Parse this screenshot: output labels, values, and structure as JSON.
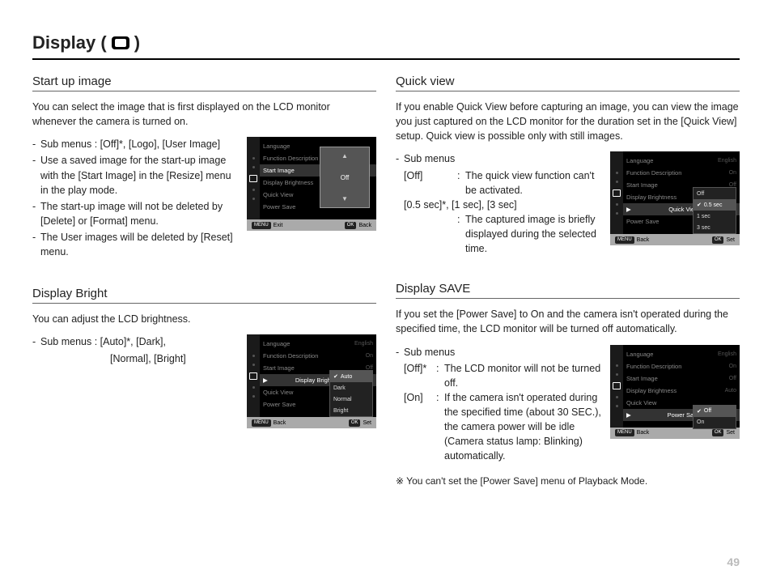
{
  "page": {
    "title_prefix": "Display (",
    "title_suffix": " )",
    "page_number": "49"
  },
  "sections": {
    "startup": {
      "title": "Start up image",
      "intro": "You can select the image that is first displayed on the LCD monitor whenever the camera is turned on.",
      "b1": "Sub menus : [Off]*, [Logo], [User Image]",
      "b2": "Use a saved image for the start-up image with the [Start Image] in the [Resize] menu in the play mode.",
      "b3": "The start-up image will not be deleted by [Delete] or [Format] menu.",
      "b4": "The User images will be deleted by [Reset] menu."
    },
    "bright": {
      "title": "Display Bright",
      "intro": "You can adjust the LCD brightness.",
      "b1": "Sub menus : [Auto]*, [Dark], [Normal], [Bright]",
      "b1_l2": "[Normal], [Bright]"
    },
    "quick": {
      "title": "Quick view",
      "intro": "If you enable Quick View before capturing an image, you can view the image you just captured on the LCD monitor for the duration set in the [Quick View] setup. Quick view is possible only with still images.",
      "sub_label": "Sub menus",
      "off_label": "[Off]",
      "off_desc": "The quick view function can't be activated.",
      "opts_label": "[0.5 sec]*, [1 sec], [3 sec]",
      "opts_desc": "The captured image is briefly displayed during the selected time."
    },
    "save": {
      "title": "Display SAVE",
      "intro": "If you set the [Power Save] to On and the camera isn't operated during the specified time, the LCD monitor will be turned off automatically.",
      "sub_label": "Sub menus",
      "off_label": "[Off]*",
      "off_desc": "The LCD monitor will not be turned off.",
      "on_label": "[On]",
      "on_desc": "If the camera isn't operated during the specified time (about 30 SEC.), the camera power will be idle (Camera status lamp: Blinking) automatically.",
      "footnote": "※ You can't set the [Power Save] menu of Playback Mode."
    }
  },
  "menu_labels": {
    "language": "Language",
    "func_desc": "Function Description",
    "start_image": "Start Image",
    "disp_bright": "Display  Brightness",
    "quick_view": "Quick View",
    "power_save": "Power Save"
  },
  "menu_values": {
    "english": "English",
    "on": "On",
    "off": "Off",
    "auto": "Auto",
    "sec05": "0.5 sec"
  },
  "footer": {
    "menu_key": "MENU",
    "ok_key": "OK",
    "exit": "Exit",
    "back": "Back",
    "set": "Set"
  },
  "popup": {
    "off": "Off"
  },
  "submenu_bright": {
    "auto": "Auto",
    "dark": "Dark",
    "normal": "Normal",
    "bright": "Bright"
  },
  "submenu_quick": {
    "off": "Off",
    "s05": "0.5 sec",
    "s1": "1 sec",
    "s3": "3 sec"
  },
  "submenu_save": {
    "off": "Off",
    "on": "On"
  }
}
